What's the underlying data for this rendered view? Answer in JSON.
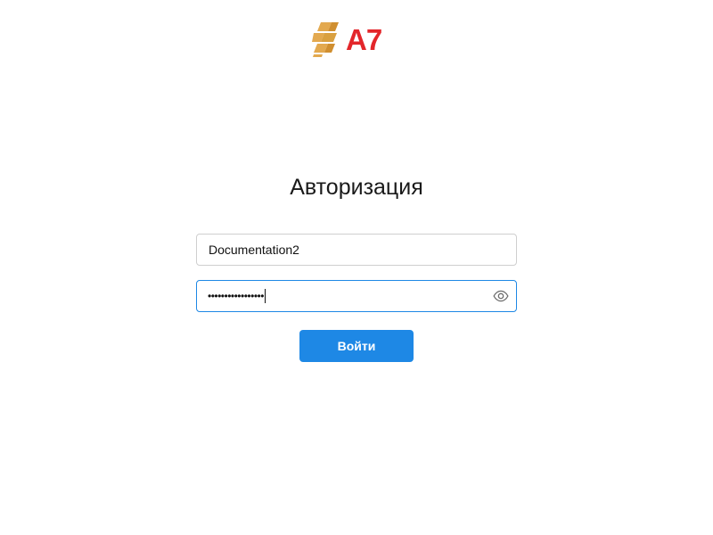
{
  "brand": {
    "logo_text": "A7",
    "logo_text_color": "#e3262a",
    "logo_mark_color": "#e3a94f",
    "logo_icon": "stacked-bricks-icon"
  },
  "auth": {
    "title": "Авторизация",
    "login_value": "Documentation2",
    "password_masked": "•••••••••••••••••",
    "password_toggle_icon": "eye-icon",
    "submit_label": "Войти",
    "accent_color": "#1e88e5"
  }
}
